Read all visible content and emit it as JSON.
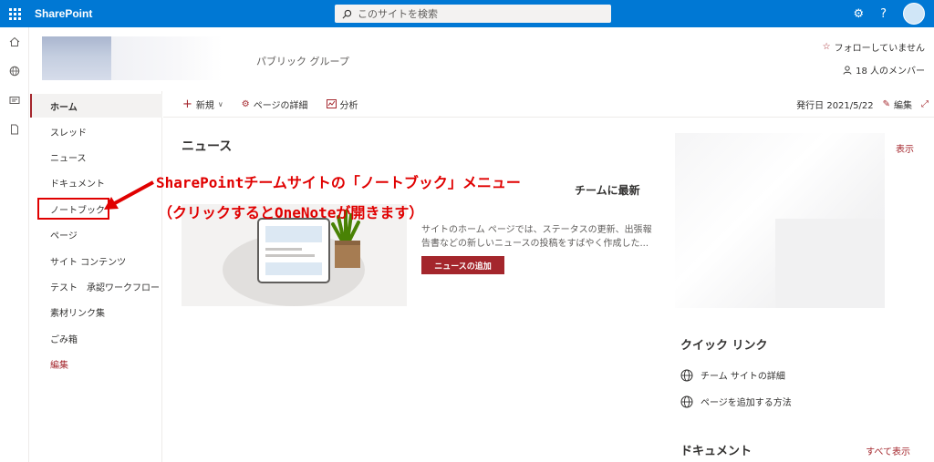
{
  "suitebar": {
    "app_name": "SharePoint",
    "search_placeholder": "このサイトを検索",
    "settings_icon": "gear-icon",
    "help_label": "?"
  },
  "site": {
    "subtitle": "パブリック グループ",
    "follow_label": "フォローしていません",
    "members_label": "18 人のメンバー"
  },
  "nav": {
    "items": [
      {
        "label": "ホーム",
        "selected": true
      },
      {
        "label": "スレッド"
      },
      {
        "label": "ニュース"
      },
      {
        "label": "ドキュメント"
      },
      {
        "label": "ノートブック"
      },
      {
        "label": "ページ"
      },
      {
        "label": "サイト コンテンツ"
      },
      {
        "label": "テスト　承認ワークフロー"
      },
      {
        "label": "素材リンク集"
      },
      {
        "label": "ごみ箱"
      }
    ],
    "edit_label": "編集"
  },
  "commandbar": {
    "new_label": "新規",
    "page_details_label": "ページの詳細",
    "analytics_label": "分析",
    "published_label": "発行日 2021/5/22",
    "edit_label": "編集"
  },
  "news": {
    "title": "ニュース",
    "headline_fragment": "チームに最新",
    "desc_line1": "サイトのホーム ページでは、ステータスの更新、出張報",
    "desc_line2": "告書などの新しいニュースの投稿をすばやく作成した...",
    "add_button": "ニュースの追加",
    "show_link": "表示"
  },
  "annotation": {
    "line1": "SharePointチームサイトの「ノートブック」メニュー",
    "line2": "（クリックするとOneNoteが開きます）",
    "color": "#e00000"
  },
  "quicklinks": {
    "title": "クイック リンク",
    "items": [
      {
        "label": "チーム サイトの詳細",
        "icon": "globe-icon"
      },
      {
        "label": "ページを追加する方法",
        "icon": "globe-icon"
      }
    ]
  },
  "documents": {
    "title": "ドキュメント",
    "show_all": "すべて表示"
  },
  "colors": {
    "suitebar": "#0078d4",
    "accent": "#a4262c"
  }
}
